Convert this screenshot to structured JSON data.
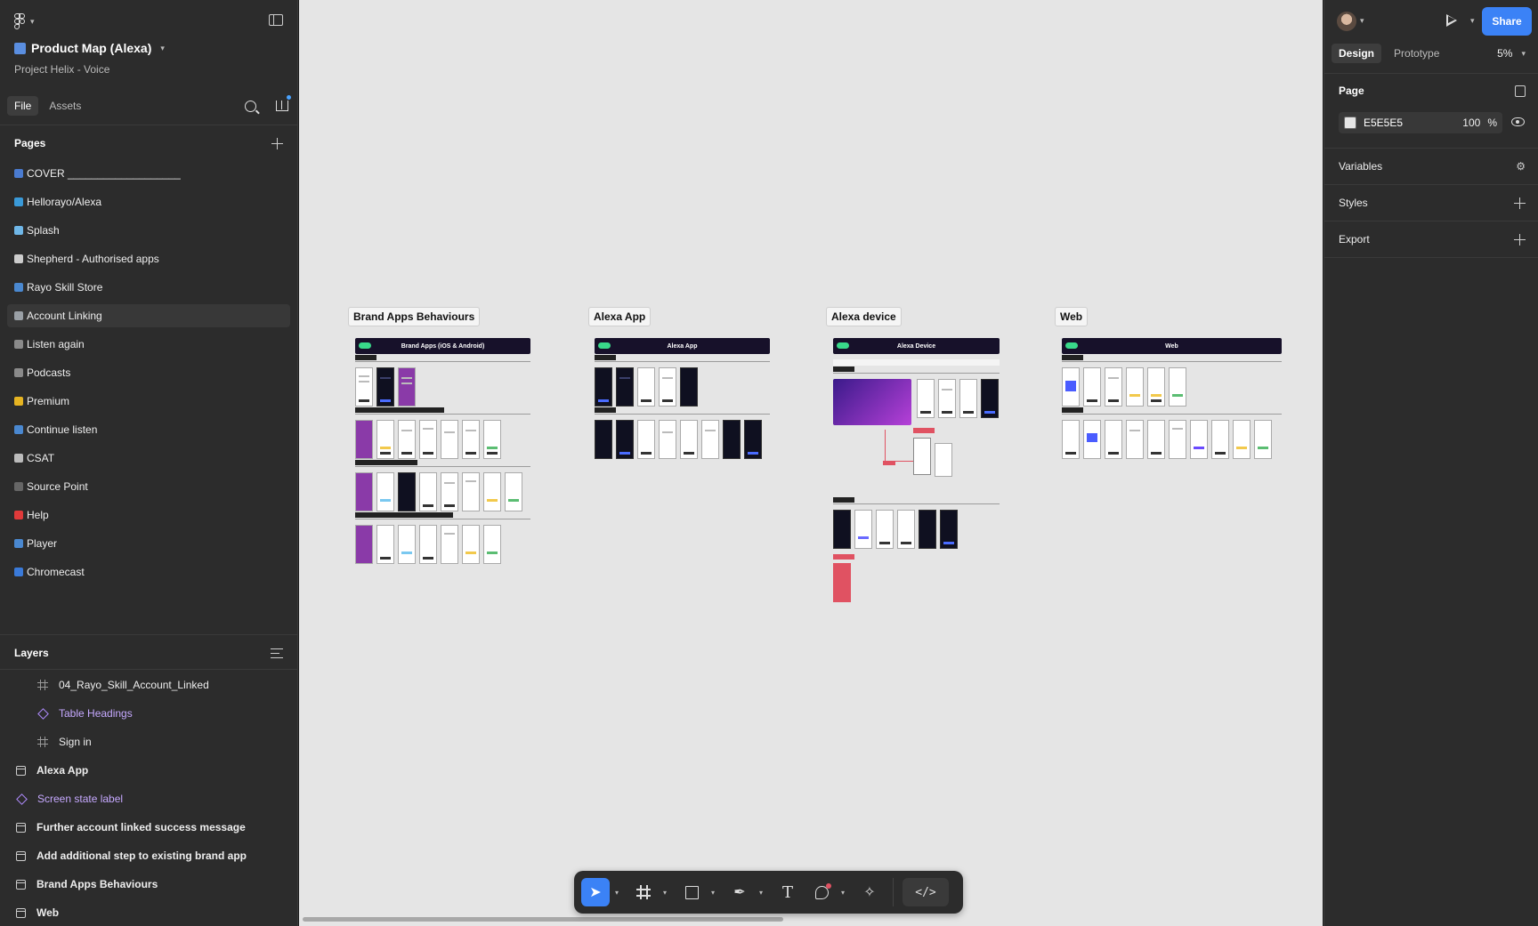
{
  "file": {
    "title": "Product Map (Alexa)",
    "subtitle": "Project Helix - Voice"
  },
  "left_tabs": {
    "file": "File",
    "assets": "Assets"
  },
  "pages_header": "Pages",
  "pages": [
    {
      "label": "COVER ___________________",
      "color": "#4a7bd0",
      "selected": false
    },
    {
      "label": "Hellorayo/Alexa",
      "color": "#3a9ad9",
      "selected": false
    },
    {
      "label": "Splash",
      "color": "#6fb7e8",
      "selected": false
    },
    {
      "label": "Shepherd - Authorised apps",
      "color": "#cccccc",
      "selected": false
    },
    {
      "label": "Rayo Skill Store",
      "color": "#4a88d0",
      "selected": false
    },
    {
      "label": "Account Linking",
      "color": "#9aa0a6",
      "selected": true
    },
    {
      "label": "Listen again",
      "color": "#8a8a8a",
      "selected": false
    },
    {
      "label": "Podcasts",
      "color": "#8a8a8a",
      "selected": false
    },
    {
      "label": "Premium",
      "color": "#e6b422",
      "selected": false
    },
    {
      "label": "Continue listen",
      "color": "#4a88d0",
      "selected": false
    },
    {
      "label": "CSAT",
      "color": "#bbbbbb",
      "selected": false
    },
    {
      "label": "Source Point",
      "color": "#666666",
      "selected": false
    },
    {
      "label": "Help",
      "color": "#e03a3a",
      "selected": false
    },
    {
      "label": "Player",
      "color": "#4a88d0",
      "selected": false
    },
    {
      "label": "Chromecast",
      "color": "#3a7ad9",
      "selected": false
    }
  ],
  "layers_header": "Layers",
  "layers": [
    {
      "label": "04_Rayo_Skill_Account_Linked",
      "kind": "frame",
      "level": 1
    },
    {
      "label": "Table Headings",
      "kind": "component",
      "level": 1
    },
    {
      "label": "Sign in",
      "kind": "frame",
      "level": 1
    },
    {
      "label": "Alexa App",
      "kind": "section",
      "level": 0
    },
    {
      "label": "Screen state label",
      "kind": "component",
      "level": 0
    },
    {
      "label": "Further account linked success message",
      "kind": "section",
      "level": 0
    },
    {
      "label": "Add additional step to existing brand app",
      "kind": "section",
      "level": 0
    },
    {
      "label": "Brand Apps Behaviours",
      "kind": "section",
      "level": 0
    },
    {
      "label": "Web",
      "kind": "section",
      "level": 0
    }
  ],
  "canvas": {
    "background": "#E5E5E5",
    "sections": [
      {
        "label": "Brand Apps Behaviours",
        "board_title": "Brand Apps (iOS & Android)"
      },
      {
        "label": "Alexa App",
        "board_title": "Alexa App"
      },
      {
        "label": "Alexa device",
        "board_title": "Alexa Device"
      },
      {
        "label": "Web",
        "board_title": "Web"
      }
    ]
  },
  "toolbar": {
    "tools": [
      "move-tool",
      "frame-tool",
      "rectangle-tool",
      "pen-tool",
      "text-tool",
      "shape-tool",
      "actions-tool",
      "dev-mode-toggle"
    ]
  },
  "right": {
    "share_label": "Share",
    "tabs": {
      "design": "Design",
      "prototype": "Prototype"
    },
    "zoom": "5%",
    "page_section": "Page",
    "page_color": "E5E5E5",
    "page_opacity": "100",
    "percent": "%",
    "variables": "Variables",
    "styles": "Styles",
    "export": "Export"
  },
  "help_label": "?",
  "accent_color": "#3B82F6"
}
